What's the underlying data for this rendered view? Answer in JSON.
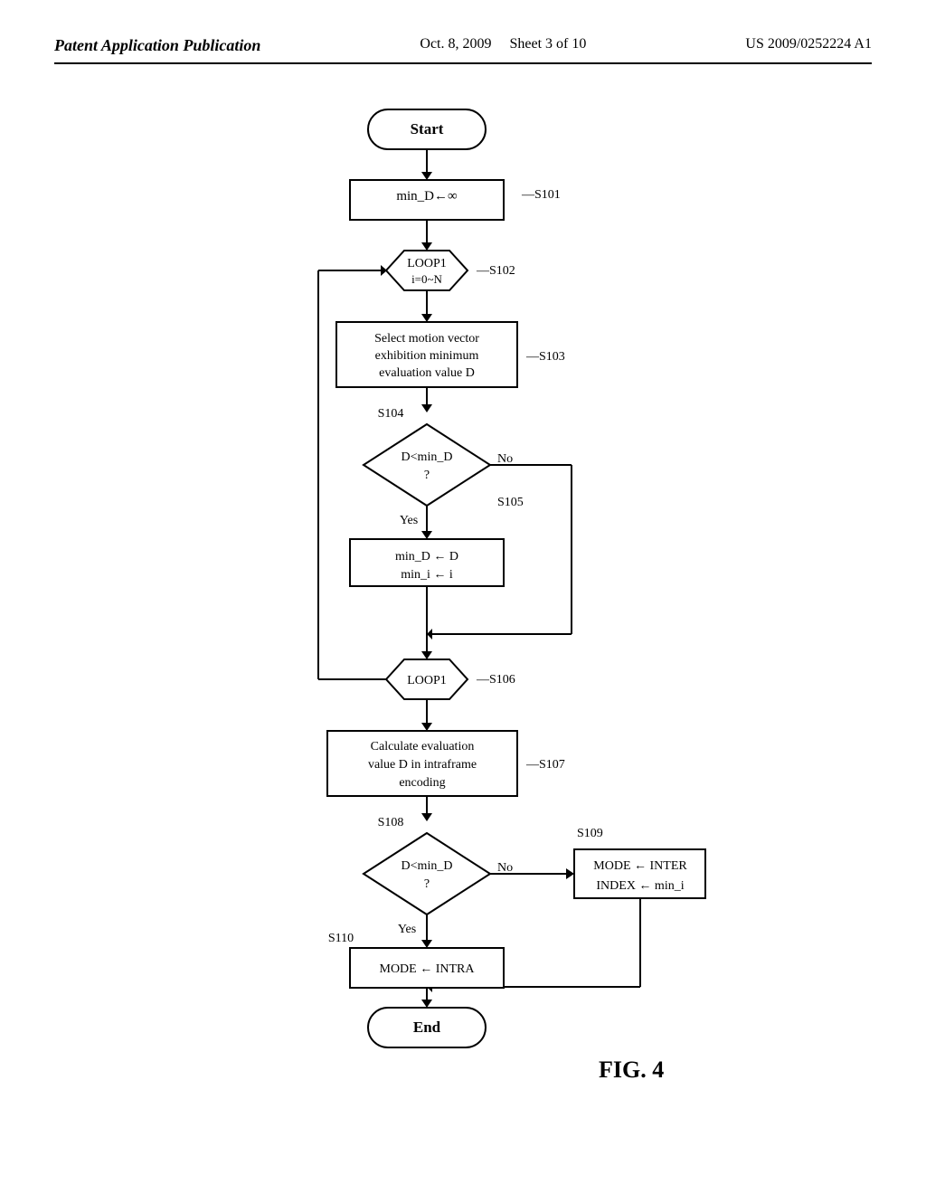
{
  "header": {
    "left": "Patent Application Publication",
    "center_date": "Oct. 8, 2009",
    "center_sheet": "Sheet 3 of 10",
    "right": "US 2009/0252224 A1"
  },
  "flowchart": {
    "title": "FIG. 4",
    "nodes": [
      {
        "id": "start",
        "type": "terminal",
        "label": "Start"
      },
      {
        "id": "s101",
        "type": "rect",
        "label": "min_D←∞",
        "step": "S101"
      },
      {
        "id": "s102",
        "type": "loop",
        "label": "LOOP1\ni=0~N",
        "step": "S102"
      },
      {
        "id": "s103",
        "type": "rect",
        "label": "Select motion vector\nexhibition minimum\nevaluation value D",
        "step": "S103"
      },
      {
        "id": "s104",
        "type": "diamond",
        "label": "D<min_D\n?",
        "step": "S104"
      },
      {
        "id": "s105",
        "type": "rect",
        "label": "min_D ← D\nmin_i ← i",
        "step": "S105"
      },
      {
        "id": "s106",
        "type": "loop",
        "label": "LOOP1",
        "step": "S106"
      },
      {
        "id": "s107",
        "type": "rect",
        "label": "Calculate evaluation\nvalue D in intraframe\nencoding",
        "step": "S107"
      },
      {
        "id": "s108",
        "type": "diamond",
        "label": "D<min_D\n?",
        "step": "S108"
      },
      {
        "id": "s110",
        "type": "rect",
        "label": "MODE ← INTRA",
        "step": "S110"
      },
      {
        "id": "s109",
        "type": "rect",
        "label": "MODE ← INTER\nINDEX ← min_i",
        "step": "S109"
      },
      {
        "id": "end",
        "type": "terminal",
        "label": "End"
      }
    ],
    "labels": {
      "yes": "Yes",
      "no": "No",
      "s108_yes": "Yes",
      "s108_no": "No",
      "s110_label": "S110",
      "s109_label": "S109"
    }
  }
}
